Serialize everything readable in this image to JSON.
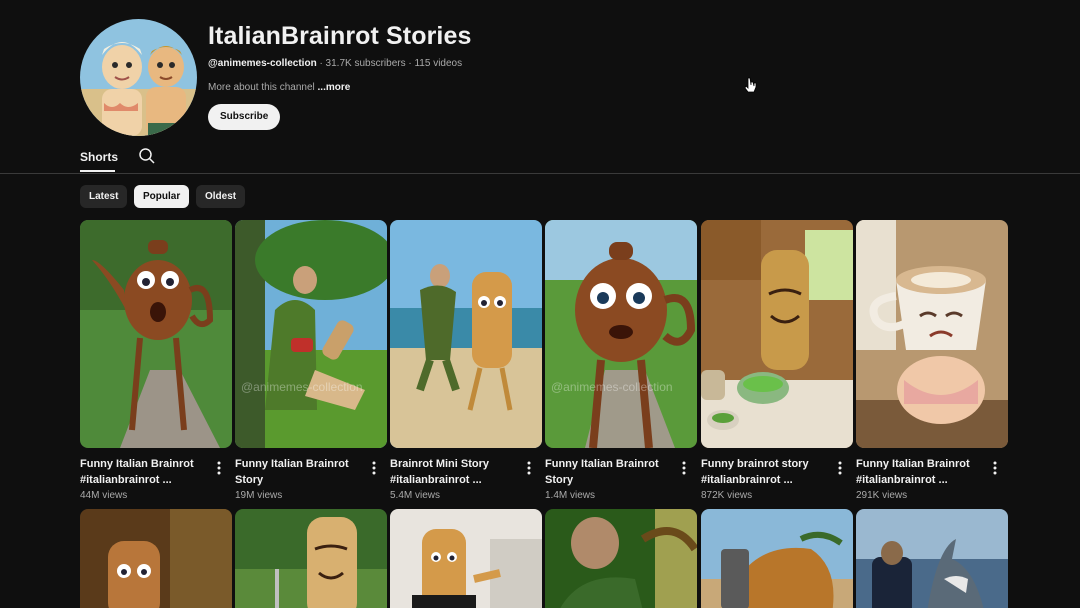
{
  "channel": {
    "title": "ItalianBrainrot Stories",
    "handle": "@animemes-collection",
    "stats": " · 31.7K subscribers · 115 videos",
    "about": "More about this channel ",
    "about_more": "...more",
    "subscribe_label": "Subscribe"
  },
  "tabs": {
    "shorts_label": "Shorts"
  },
  "chips": [
    {
      "label": "Latest"
    },
    {
      "label": "Popular"
    },
    {
      "label": "Oldest"
    }
  ],
  "watermark": "@animemes-collection",
  "shorts": [
    {
      "title": "Funny Italian Brainrot #italianbrainrot ...",
      "views": "44M views"
    },
    {
      "title": "Funny Italian Brainrot Story",
      "views": "19M views"
    },
    {
      "title": "Brainrot Mini Story #italianbrainrot ...",
      "views": "5.4M views"
    },
    {
      "title": "Funny Italian Brainrot Story",
      "views": "1.4M views"
    },
    {
      "title": "Funny brainrot story #italianbrainrot ...",
      "views": "872K views"
    },
    {
      "title": "Funny Italian Brainrot #italianbrainrot ...",
      "views": "291K views"
    }
  ],
  "icons": {
    "search": "search-icon",
    "more": "more-vert-icon",
    "cursor": "mouse-pointer-icon"
  },
  "colors": {
    "background": "#0f0f0f",
    "chip_bg": "#272727",
    "chip_active_bg": "#f1f1f1",
    "text_primary": "#f1f1f1",
    "text_secondary": "#aaaaaa"
  }
}
